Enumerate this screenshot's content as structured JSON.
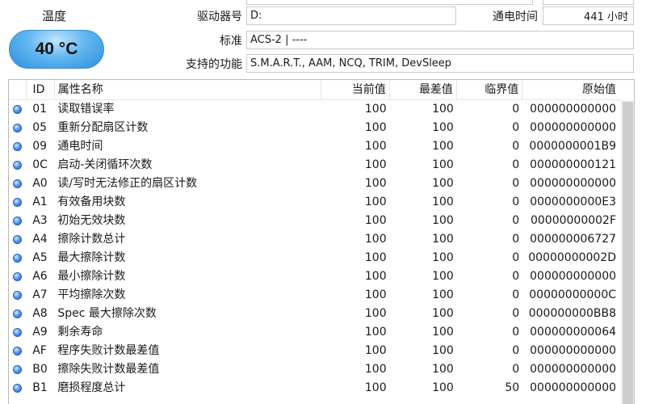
{
  "temperature": {
    "label": "温度",
    "value": "40 °C"
  },
  "fields": {
    "drive_letter": {
      "label": "驱动器号",
      "value": "D:"
    },
    "power_on_hours": {
      "label": "通电时间",
      "value": "441 小时"
    },
    "standard": {
      "label": "标准",
      "value": "ACS-2 | ----"
    },
    "features": {
      "label": "支持的功能",
      "value": "S.M.A.R.T., AAM, NCQ, TRIM, DevSleep"
    }
  },
  "table": {
    "headers": {
      "id": "ID",
      "name": "属性名称",
      "current": "当前值",
      "worst": "最差值",
      "threshold": "临界值",
      "raw": "原始值"
    },
    "rows": [
      {
        "id": "01",
        "name": "读取错误率",
        "current": "100",
        "worst": "100",
        "threshold": "0",
        "raw": "000000000000"
      },
      {
        "id": "05",
        "name": "重新分配扇区计数",
        "current": "100",
        "worst": "100",
        "threshold": "0",
        "raw": "000000000000"
      },
      {
        "id": "09",
        "name": "通电时间",
        "current": "100",
        "worst": "100",
        "threshold": "0",
        "raw": "0000000001B9"
      },
      {
        "id": "0C",
        "name": "启动-关闭循环次数",
        "current": "100",
        "worst": "100",
        "threshold": "0",
        "raw": "000000000121"
      },
      {
        "id": "A0",
        "name": "读/写时无法修正的扇区计数",
        "current": "100",
        "worst": "100",
        "threshold": "0",
        "raw": "000000000000"
      },
      {
        "id": "A1",
        "name": "有效备用块数",
        "current": "100",
        "worst": "100",
        "threshold": "0",
        "raw": "0000000000E3"
      },
      {
        "id": "A3",
        "name": "初始无效块数",
        "current": "100",
        "worst": "100",
        "threshold": "0",
        "raw": "00000000002F"
      },
      {
        "id": "A4",
        "name": "擦除计数总计",
        "current": "100",
        "worst": "100",
        "threshold": "0",
        "raw": "000000006727"
      },
      {
        "id": "A5",
        "name": "最大擦除计数",
        "current": "100",
        "worst": "100",
        "threshold": "0",
        "raw": "00000000002D"
      },
      {
        "id": "A6",
        "name": "最小擦除计数",
        "current": "100",
        "worst": "100",
        "threshold": "0",
        "raw": "000000000000"
      },
      {
        "id": "A7",
        "name": "平均擦除次数",
        "current": "100",
        "worst": "100",
        "threshold": "0",
        "raw": "00000000000C"
      },
      {
        "id": "A8",
        "name": "Spec 最大擦除次数",
        "current": "100",
        "worst": "100",
        "threshold": "0",
        "raw": "000000000BB8"
      },
      {
        "id": "A9",
        "name": "剩余寿命",
        "current": "100",
        "worst": "100",
        "threshold": "0",
        "raw": "000000000064"
      },
      {
        "id": "AF",
        "name": "程序失败计数最差值",
        "current": "100",
        "worst": "100",
        "threshold": "0",
        "raw": "000000000000"
      },
      {
        "id": "B0",
        "name": "擦除失败计数最差值",
        "current": "100",
        "worst": "100",
        "threshold": "0",
        "raw": "000000000000"
      },
      {
        "id": "B1",
        "name": "磨损程度总计",
        "current": "100",
        "worst": "100",
        "threshold": "50",
        "raw": "000000000000"
      }
    ]
  }
}
